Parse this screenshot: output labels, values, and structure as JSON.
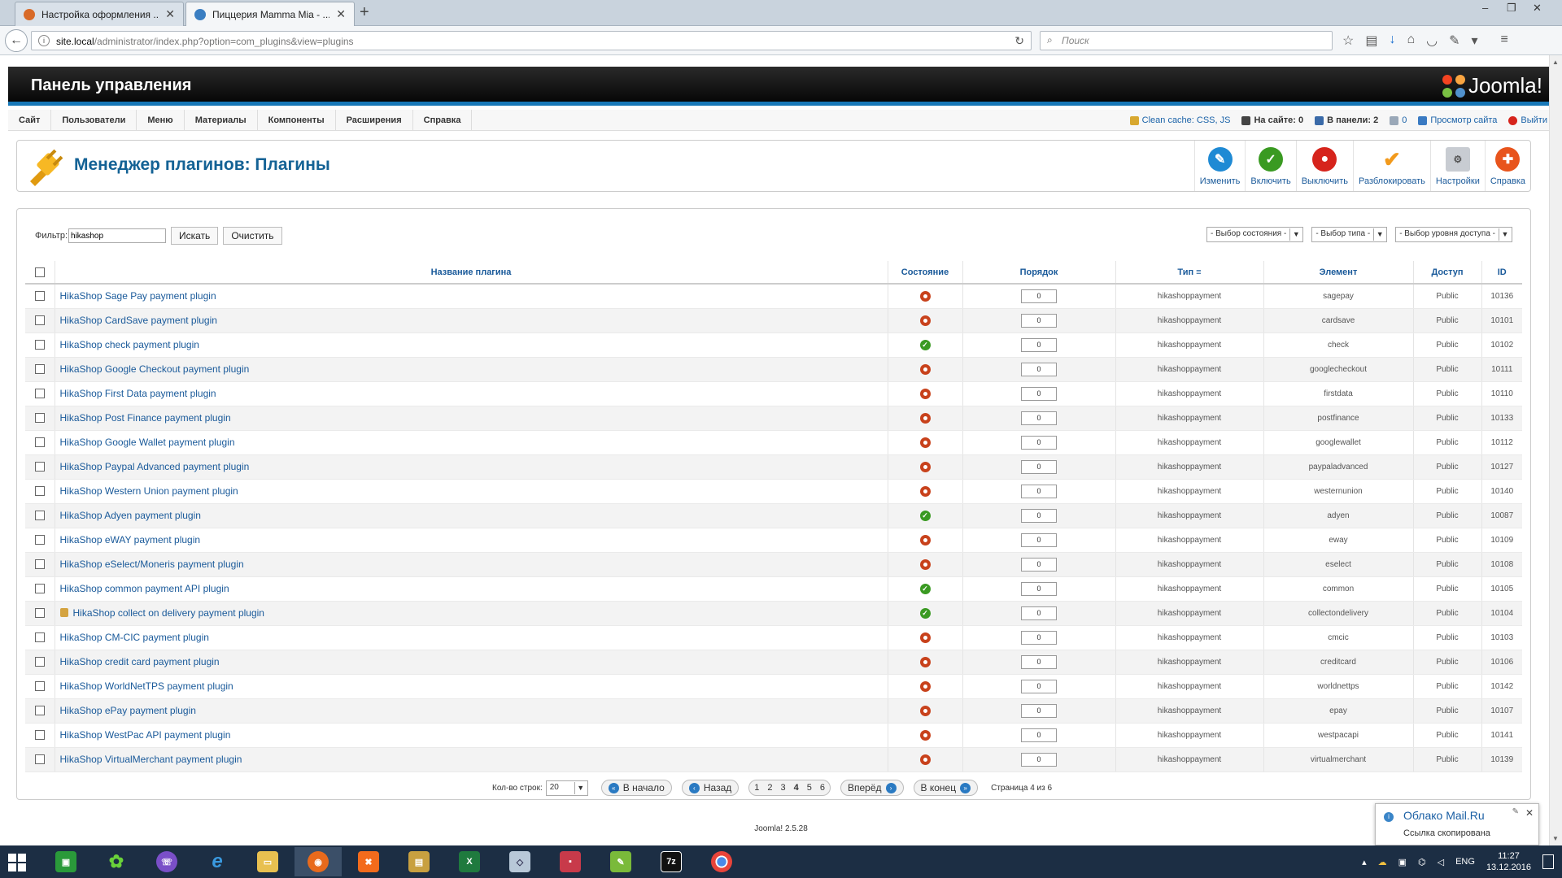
{
  "browser": {
    "tabs": [
      {
        "label": "Настройка оформления ...",
        "active": false
      },
      {
        "label": "Пиццерия Mamma Mia - ...",
        "active": true
      }
    ],
    "url_host": "site.local",
    "url_path": "/administrator/index.php?option=com_plugins&view=plugins",
    "search_placeholder": "Поиск"
  },
  "header": {
    "title": "Панель управления",
    "logo_text": "Joomla!"
  },
  "menu": [
    "Сайт",
    "Пользователи",
    "Меню",
    "Материалы",
    "Компоненты",
    "Расширения",
    "Справка"
  ],
  "status": {
    "cache": "Clean cache: CSS, JS",
    "on_site": "На сайте: 0",
    "in_panel": "В панели: 2",
    "messages": "0",
    "preview": "Просмотр сайта",
    "logout": "Выйти"
  },
  "page": {
    "title": "Менеджер плагинов: Плагины"
  },
  "toolbar": [
    {
      "label": "Изменить",
      "icon": "edit-icon",
      "color": "#1f8ad4"
    },
    {
      "label": "Включить",
      "icon": "check-icon",
      "color": "#3a9a22"
    },
    {
      "label": "Выключить",
      "icon": "stop-icon",
      "color": "#d6241c"
    },
    {
      "label": "Разблокировать",
      "icon": "checkin-icon",
      "color": "#f29a1c"
    },
    {
      "label": "Настройки",
      "icon": "options-icon",
      "color": "#8a8f96"
    },
    {
      "label": "Справка",
      "icon": "help-icon",
      "color": "#e8541c"
    }
  ],
  "filter": {
    "label": "Фильтр:",
    "value": "hikashop",
    "search_button": "Искать",
    "clear_button": "Очистить",
    "state_select": "- Выбор состояния -",
    "type_select": "- Выбор типа -",
    "access_select": "- Выбор уровня доступа -"
  },
  "table": {
    "columns": [
      "Название плагина",
      "Состояние",
      "Порядок",
      "Тип",
      "Элемент",
      "Доступ",
      "ID"
    ],
    "rows": [
      {
        "name": "HikaShop Sage Pay payment plugin",
        "enabled": false,
        "order": "0",
        "type": "hikashoppayment",
        "element": "sagepay",
        "access": "Public",
        "id": "10136",
        "locked": false
      },
      {
        "name": "HikaShop CardSave payment plugin",
        "enabled": false,
        "order": "0",
        "type": "hikashoppayment",
        "element": "cardsave",
        "access": "Public",
        "id": "10101",
        "locked": false
      },
      {
        "name": "HikaShop check payment plugin",
        "enabled": true,
        "order": "0",
        "type": "hikashoppayment",
        "element": "check",
        "access": "Public",
        "id": "10102",
        "locked": false
      },
      {
        "name": "HikaShop Google Checkout payment plugin",
        "enabled": false,
        "order": "0",
        "type": "hikashoppayment",
        "element": "googlecheckout",
        "access": "Public",
        "id": "10111",
        "locked": false
      },
      {
        "name": "HikaShop First Data payment plugin",
        "enabled": false,
        "order": "0",
        "type": "hikashoppayment",
        "element": "firstdata",
        "access": "Public",
        "id": "10110",
        "locked": false
      },
      {
        "name": "HikaShop Post Finance payment plugin",
        "enabled": false,
        "order": "0",
        "type": "hikashoppayment",
        "element": "postfinance",
        "access": "Public",
        "id": "10133",
        "locked": false
      },
      {
        "name": "HikaShop Google Wallet payment plugin",
        "enabled": false,
        "order": "0",
        "type": "hikashoppayment",
        "element": "googlewallet",
        "access": "Public",
        "id": "10112",
        "locked": false
      },
      {
        "name": "HikaShop Paypal Advanced payment plugin",
        "enabled": false,
        "order": "0",
        "type": "hikashoppayment",
        "element": "paypaladvanced",
        "access": "Public",
        "id": "10127",
        "locked": false
      },
      {
        "name": "HikaShop Western Union payment plugin",
        "enabled": false,
        "order": "0",
        "type": "hikashoppayment",
        "element": "westernunion",
        "access": "Public",
        "id": "10140",
        "locked": false
      },
      {
        "name": "HikaShop Adyen payment plugin",
        "enabled": true,
        "order": "0",
        "type": "hikashoppayment",
        "element": "adyen",
        "access": "Public",
        "id": "10087",
        "locked": false
      },
      {
        "name": "HikaShop eWAY payment plugin",
        "enabled": false,
        "order": "0",
        "type": "hikashoppayment",
        "element": "eway",
        "access": "Public",
        "id": "10109",
        "locked": false
      },
      {
        "name": "HikaShop eSelect/Moneris payment plugin",
        "enabled": false,
        "order": "0",
        "type": "hikashoppayment",
        "element": "eselect",
        "access": "Public",
        "id": "10108",
        "locked": false
      },
      {
        "name": "HikaShop common payment API plugin",
        "enabled": true,
        "order": "0",
        "type": "hikashoppayment",
        "element": "common",
        "access": "Public",
        "id": "10105",
        "locked": false
      },
      {
        "name": "HikaShop collect on delivery payment plugin",
        "enabled": true,
        "order": "0",
        "type": "hikashoppayment",
        "element": "collectondelivery",
        "access": "Public",
        "id": "10104",
        "locked": true
      },
      {
        "name": "HikaShop CM-CIC payment plugin",
        "enabled": false,
        "order": "0",
        "type": "hikashoppayment",
        "element": "cmcic",
        "access": "Public",
        "id": "10103",
        "locked": false
      },
      {
        "name": "HikaShop credit card payment plugin",
        "enabled": false,
        "order": "0",
        "type": "hikashoppayment",
        "element": "creditcard",
        "access": "Public",
        "id": "10106",
        "locked": false
      },
      {
        "name": "HikaShop WorldNetTPS payment plugin",
        "enabled": false,
        "order": "0",
        "type": "hikashoppayment",
        "element": "worldnettps",
        "access": "Public",
        "id": "10142",
        "locked": false
      },
      {
        "name": "HikaShop ePay payment plugin",
        "enabled": false,
        "order": "0",
        "type": "hikashoppayment",
        "element": "epay",
        "access": "Public",
        "id": "10107",
        "locked": false
      },
      {
        "name": "HikaShop WestPac API payment plugin",
        "enabled": false,
        "order": "0",
        "type": "hikashoppayment",
        "element": "westpacapi",
        "access": "Public",
        "id": "10141",
        "locked": false
      },
      {
        "name": "HikaShop VirtualMerchant payment plugin",
        "enabled": false,
        "order": "0",
        "type": "hikashoppayment",
        "element": "virtualmerchant",
        "access": "Public",
        "id": "10139",
        "locked": false
      }
    ]
  },
  "pagination": {
    "rows_label": "Кол-во строк:",
    "rows_value": "20",
    "first": "В начало",
    "prev": "Назад",
    "pages": [
      "1",
      "2",
      "3",
      "4",
      "5",
      "6"
    ],
    "current": "4",
    "next": "Вперёд",
    "last": "В конец",
    "summary": "Страница 4 из 6"
  },
  "footer": "Joomla! 2.5.28",
  "notification": {
    "title": "Облако Mail.Ru",
    "text": "Ссылка скопирована"
  },
  "taskbar": {
    "lang": "ENG",
    "time": "11:27",
    "date": "13.12.2016"
  }
}
